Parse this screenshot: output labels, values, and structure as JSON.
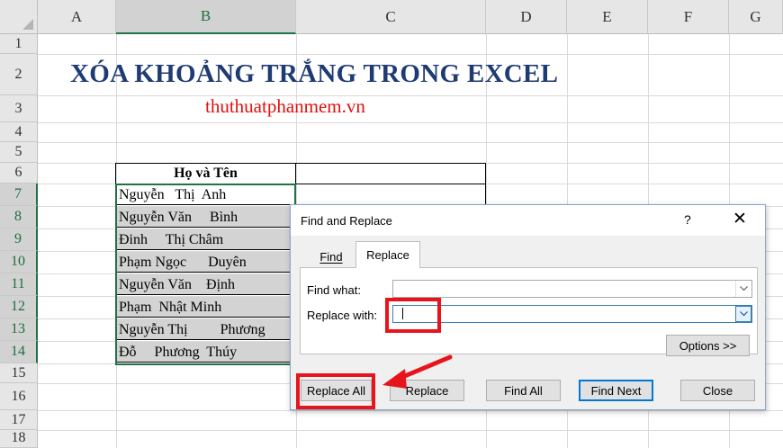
{
  "spreadsheet": {
    "columns": [
      "A",
      "B",
      "C",
      "D",
      "E",
      "F",
      "G"
    ],
    "rows": [
      "1",
      "2",
      "3",
      "4",
      "5",
      "6",
      "7",
      "8",
      "9",
      "10",
      "11",
      "12",
      "13",
      "14",
      "15",
      "16",
      "17",
      "18"
    ],
    "selected_column": "B",
    "selected_rows": [
      "7",
      "8",
      "9",
      "10",
      "11",
      "12",
      "13",
      "14"
    ],
    "title": "XÓA KHOẢNG TRẮNG TRONG EXCEL",
    "site": "thuthuatphanmem.vn",
    "table_header": "Họ và Tên",
    "names": [
      "Nguyễn   Thị  Anh",
      "Nguyễn Văn     Bình",
      "Đinh     Thị Châm",
      "Phạm Ngọc      Duyên",
      "Nguyễn Văn    Định",
      "Phạm  Nhật Minh",
      "Nguyễn Thị         Phương",
      "Đỗ     Phương  Thúy"
    ]
  },
  "dialog": {
    "title": "Find and Replace",
    "help": "?",
    "close": "✕",
    "tabs": {
      "find": "Find",
      "replace": "Replace"
    },
    "find_what_label": "Find what:",
    "find_what_value": "",
    "replace_with_label": "Replace with:",
    "replace_with_value": " ",
    "options_button": "Options >>",
    "buttons": {
      "replace_all": "Replace All",
      "replace": "Replace",
      "find_all": "Find All",
      "find_next": "Find Next",
      "close": "Close"
    }
  },
  "annotation": {
    "color": "#e8141c"
  },
  "icons": {
    "dropdown": "chevron-down-icon",
    "close": "close-icon"
  }
}
